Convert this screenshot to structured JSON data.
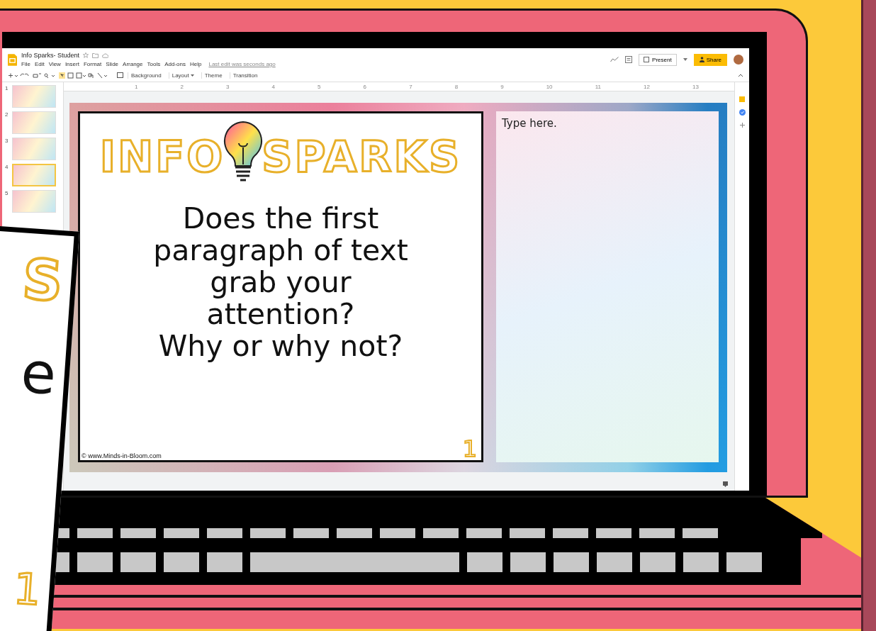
{
  "app": {
    "title": "Info Sparks- Student",
    "menu": [
      "File",
      "Edit",
      "View",
      "Insert",
      "Format",
      "Slide",
      "Arrange",
      "Tools",
      "Add-ons",
      "Help"
    ],
    "last_edit": "Last edit was seconds ago",
    "present_button": "Present",
    "share_button": "Share"
  },
  "toolbar": {
    "buttons": [
      {
        "label": "Background",
        "dropdown": false
      },
      {
        "label": "Layout",
        "dropdown": true
      },
      {
        "label": "Theme",
        "dropdown": false
      },
      {
        "label": "Transition",
        "dropdown": false
      }
    ]
  },
  "ruler": [
    "1",
    "2",
    "3",
    "4",
    "5",
    "6",
    "7",
    "8",
    "9",
    "10",
    "11",
    "12",
    "13"
  ],
  "filmstrip": [
    {
      "number": "1",
      "selected": false
    },
    {
      "number": "2",
      "selected": false
    },
    {
      "number": "3",
      "selected": false
    },
    {
      "number": "4",
      "selected": true
    },
    {
      "number": "5",
      "selected": false
    }
  ],
  "slide": {
    "logo": [
      "INFO",
      "SPARKS"
    ],
    "question": [
      "Does the first",
      "paragraph of text",
      "grab your",
      "attention?",
      "Why or why not?"
    ],
    "credit": "© www.Minds-in-Bloom.com",
    "card_number": "1",
    "answer_text": "Type here."
  },
  "overlay_card": {
    "logo_fragment": "S",
    "text_fragment": "e",
    "number_fragment": "1"
  }
}
